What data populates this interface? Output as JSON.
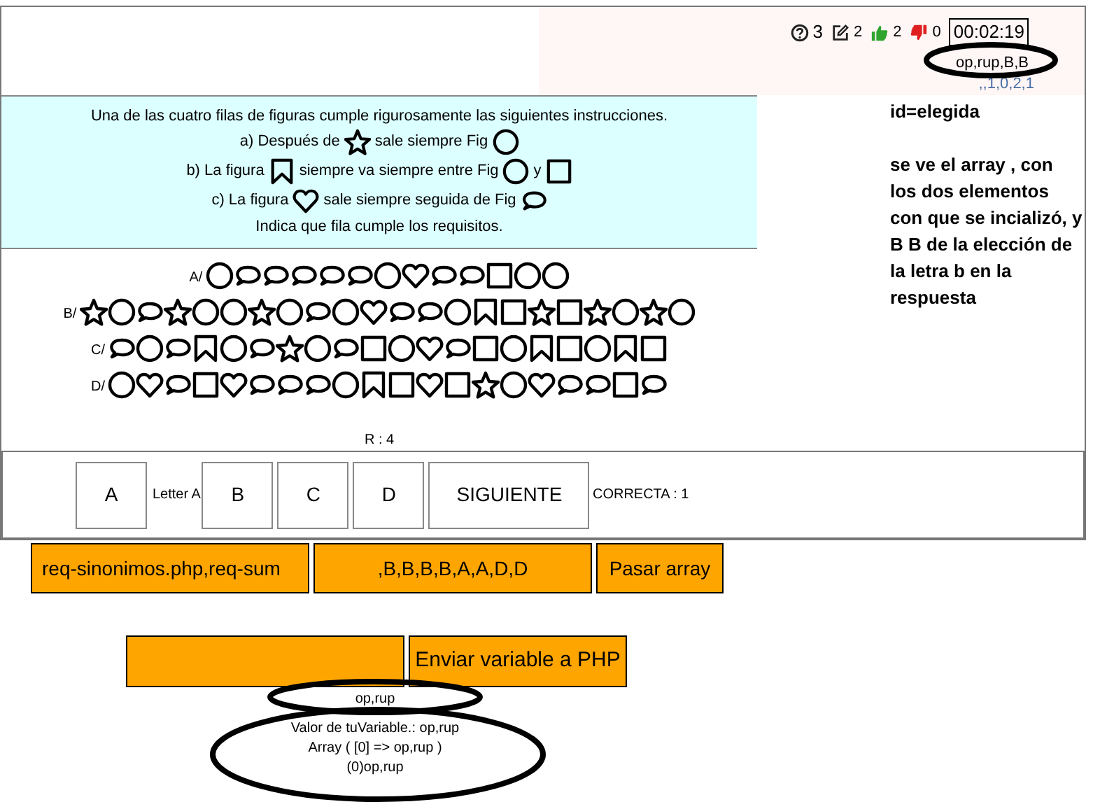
{
  "header": {
    "stats": [
      {
        "kind": "help",
        "count": "3"
      },
      {
        "kind": "edit",
        "count": "2"
      },
      {
        "kind": "like",
        "count": "2"
      },
      {
        "kind": "dislike",
        "count": "0"
      }
    ],
    "timer": "00:02:19",
    "array_text": "op,rup,B,B",
    "indices": ",,1,0,2,1"
  },
  "instructions": {
    "intro": "Una de las cuatro filas de figuras cumple rigurosamente las siguientes instrucciones.",
    "rules": [
      [
        {
          "kind": "text",
          "text": "a) Después de"
        },
        {
          "kind": "star"
        },
        {
          "kind": "text",
          "text": "sale siempre Fig"
        },
        {
          "kind": "circle"
        }
      ],
      [
        {
          "kind": "text",
          "text": "b) La figura"
        },
        {
          "kind": "bookmark"
        },
        {
          "kind": "text",
          "text": "siempre va siempre entre Fig"
        },
        {
          "kind": "circle"
        },
        {
          "kind": "text",
          "text": "y"
        },
        {
          "kind": "square"
        }
      ],
      [
        {
          "kind": "text",
          "text": "c) La figura"
        },
        {
          "kind": "heart"
        },
        {
          "kind": "text",
          "text": "sale siempre seguida de Fig"
        },
        {
          "kind": "speech"
        }
      ]
    ],
    "outro": "Indica que fila cumple los requisitos."
  },
  "note": {
    "title": "id=elegida",
    "body": "se ve el array , con los dos elementos con que se incializó, y B B de la elección de la letra b en la respuesta"
  },
  "rows": [
    {
      "label": "A/",
      "shapes": [
        {
          "kind": "circle"
        },
        {
          "kind": "speech"
        },
        {
          "kind": "speech"
        },
        {
          "kind": "speech"
        },
        {
          "kind": "speech"
        },
        {
          "kind": "speech"
        },
        {
          "kind": "circle"
        },
        {
          "kind": "heart"
        },
        {
          "kind": "speech"
        },
        {
          "kind": "speech"
        },
        {
          "kind": "square"
        },
        {
          "kind": "circle"
        },
        {
          "kind": "circle"
        }
      ]
    },
    {
      "label": "B/",
      "shapes": [
        {
          "kind": "star"
        },
        {
          "kind": "circle"
        },
        {
          "kind": "speech"
        },
        {
          "kind": "star"
        },
        {
          "kind": "circle"
        },
        {
          "kind": "circle"
        },
        {
          "kind": "star"
        },
        {
          "kind": "circle"
        },
        {
          "kind": "speech"
        },
        {
          "kind": "circle"
        },
        {
          "kind": "heart"
        },
        {
          "kind": "speech"
        },
        {
          "kind": "speech"
        },
        {
          "kind": "circle"
        },
        {
          "kind": "bookmark"
        },
        {
          "kind": "square"
        },
        {
          "kind": "star"
        },
        {
          "kind": "square"
        },
        {
          "kind": "star"
        },
        {
          "kind": "circle"
        },
        {
          "kind": "star"
        },
        {
          "kind": "circle"
        }
      ]
    },
    {
      "label": "C/",
      "shapes": [
        {
          "kind": "speech"
        },
        {
          "kind": "circle"
        },
        {
          "kind": "speech"
        },
        {
          "kind": "bookmark"
        },
        {
          "kind": "circle"
        },
        {
          "kind": "speech"
        },
        {
          "kind": "star"
        },
        {
          "kind": "circle"
        },
        {
          "kind": "speech"
        },
        {
          "kind": "square"
        },
        {
          "kind": "circle"
        },
        {
          "kind": "heart"
        },
        {
          "kind": "speech"
        },
        {
          "kind": "square"
        },
        {
          "kind": "circle"
        },
        {
          "kind": "bookmark"
        },
        {
          "kind": "square"
        },
        {
          "kind": "circle"
        },
        {
          "kind": "bookmark"
        },
        {
          "kind": "square"
        }
      ]
    },
    {
      "label": "D/",
      "shapes": [
        {
          "kind": "circle"
        },
        {
          "kind": "heart"
        },
        {
          "kind": "speech"
        },
        {
          "kind": "square"
        },
        {
          "kind": "heart"
        },
        {
          "kind": "speech"
        },
        {
          "kind": "speech"
        },
        {
          "kind": "speech"
        },
        {
          "kind": "circle"
        },
        {
          "kind": "bookmark"
        },
        {
          "kind": "square"
        },
        {
          "kind": "heart"
        },
        {
          "kind": "square"
        },
        {
          "kind": "star"
        },
        {
          "kind": "circle"
        },
        {
          "kind": "heart"
        },
        {
          "kind": "speech"
        },
        {
          "kind": "speech"
        },
        {
          "kind": "square"
        },
        {
          "kind": "speech"
        }
      ]
    }
  ],
  "result": "R : 4",
  "answers": [
    {
      "kind": "button",
      "label": "A"
    },
    {
      "kind": "text",
      "label": "Letter A"
    },
    {
      "kind": "button",
      "label": "B"
    },
    {
      "kind": "button",
      "label": "C"
    },
    {
      "kind": "button",
      "label": "D"
    },
    {
      "kind": "wide",
      "label": "SIGUIENTE"
    },
    {
      "kind": "text",
      "label": "CORRECTA : 1"
    }
  ],
  "array_form": {
    "files": "req-sinonimos.php,req-sum",
    "letters": ",B,B,B,B,A,A,D,D",
    "button": "Pasar array"
  },
  "php_form": {
    "button": "Enviar variable a PHP"
  },
  "output": {
    "sent": "op,rup",
    "lines": [
      "Valor de tuVariable.: op,rup",
      "Array ( [0] => op,rup )",
      "(0)op,rup"
    ]
  }
}
